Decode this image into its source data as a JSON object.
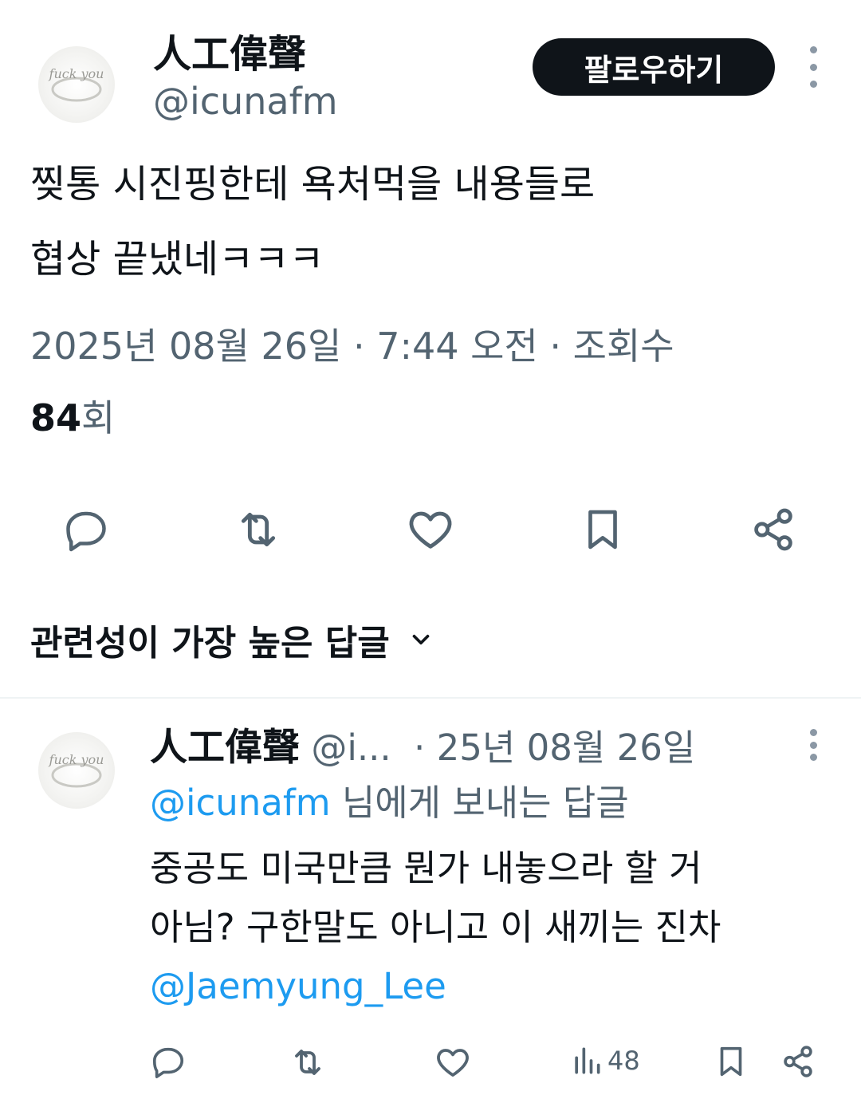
{
  "tweet": {
    "author": {
      "display_name": "人工偉聲",
      "handle": "@icunafm",
      "avatar_text": "fuck you"
    },
    "follow_label": "팔로우하기",
    "text_line1": "찢통 시진핑한테 욕처먹을 내용들로",
    "text_line2": "협상 끝냈네ㅋㅋㅋ",
    "meta_line": "2025년 08월 26일 · 7:44 오전 · 조회수",
    "views_count": "84",
    "views_unit": "회",
    "actions": {
      "reply_icon": "reply-icon",
      "retweet_icon": "retweet-icon",
      "like_icon": "heart-icon",
      "bookmark_icon": "bookmark-icon",
      "share_icon": "share-icon"
    }
  },
  "replies_section": {
    "sort_label": "관련성이 가장 높은 답글"
  },
  "reply": {
    "display_name": "人工偉聲",
    "handle_truncated": "@i...",
    "date": "· 25년 08월 26일",
    "replying_to_handle": "@icunafm",
    "replying_to_suffix": " 님에게 보내는 답글",
    "text_line1": "중공도 미국만큼 뭔가 내놓으라 할 거",
    "text_line2": "아님? 구한말도 아니고 이 새끼는 진차",
    "mention": "@Jaemyung_Lee",
    "views": "48"
  },
  "colors": {
    "text": "#0f1419",
    "secondary": "#536471",
    "link": "#1d9bf0",
    "button_bg": "#0f1419"
  }
}
